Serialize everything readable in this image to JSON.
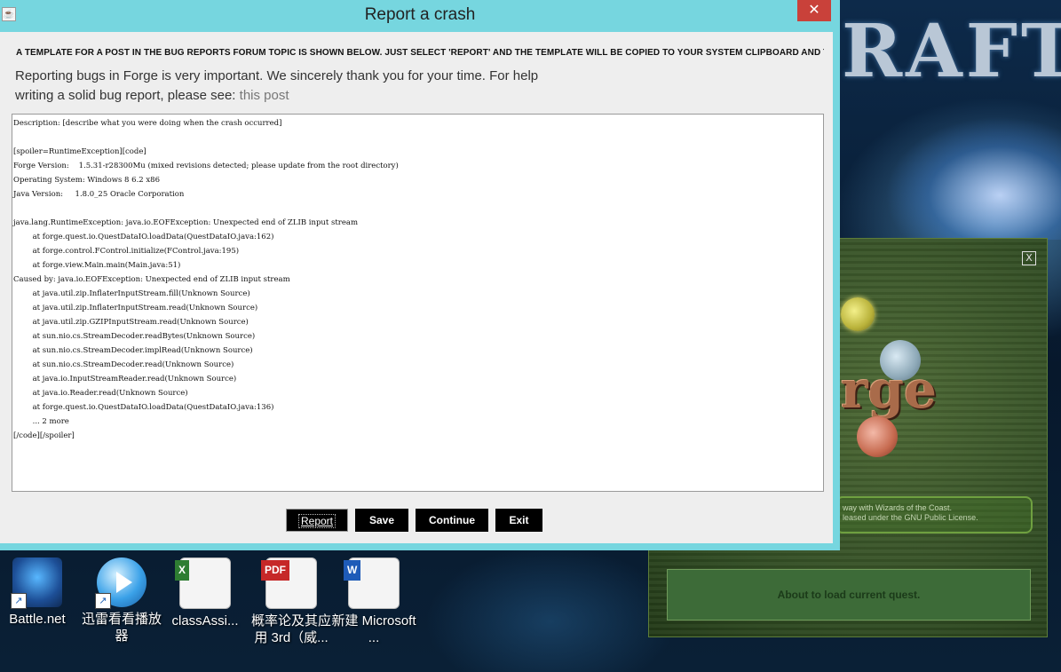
{
  "window": {
    "title": "Report a crash",
    "close_glyph": "✕",
    "app_icon": "java-cup-icon"
  },
  "dialog": {
    "template_note": "A TEMPLATE FOR A POST IN THE BUG REPORTS FORUM TOPIC IS SHOWN BELOW. JUST SELECT 'REPORT' AND THE TEMPLATE WILL BE COPIED TO YOUR SYSTEM CLIPBOARD AND THE FORUM PAGE WILL OPEN IN YOU",
    "intro_line1": "Reporting bugs in Forge is very important. We sincerely thank you for your time. For help",
    "intro_line2": "writing a solid bug report, please see:",
    "link_text": "this post",
    "report_text": "Description: [describe what you were doing when the crash occurred]\n\n[spoiler=RuntimeException][code]\nForge Version:    1.5.31-r28300Mu (mixed revisions detected; please update from the root directory)\nOperating System: Windows 8 6.2 x86\nJava Version:     1.8.0_25 Oracle Corporation\n\njava.lang.RuntimeException: java.io.EOFException: Unexpected end of ZLIB input stream\n        at forge.quest.io.QuestDataIO.loadData(QuestDataIO.java:162)\n        at forge.control.FControl.initialize(FControl.java:195)\n        at forge.view.Main.main(Main.java:51)\nCaused by: java.io.EOFException: Unexpected end of ZLIB input stream\n        at java.util.zip.InflaterInputStream.fill(Unknown Source)\n        at java.util.zip.InflaterInputStream.read(Unknown Source)\n        at java.util.zip.GZIPInputStream.read(Unknown Source)\n        at sun.nio.cs.StreamDecoder.readBytes(Unknown Source)\n        at sun.nio.cs.StreamDecoder.implRead(Unknown Source)\n        at sun.nio.cs.StreamDecoder.read(Unknown Source)\n        at java.io.InputStreamReader.read(Unknown Source)\n        at java.io.Reader.read(Unknown Source)\n        at forge.quest.io.QuestDataIO.loadData(QuestDataIO.java:136)\n        ... 2 more\n[/code][/spoiler]",
    "buttons": {
      "report": "Report",
      "save": "Save",
      "continue": "Continue",
      "exit": "Exit"
    }
  },
  "splash": {
    "close_glyph": "X",
    "logo_text": "rge",
    "license_line1": "way with Wizards of the Coast.",
    "license_line2": "leased under the GNU Public License.",
    "status": "About to load current quest."
  },
  "background": {
    "logo_text": "RAFT"
  },
  "desktop_icons": [
    {
      "label": "Battle.net",
      "icon": "battlenet-icon"
    },
    {
      "label": "迅雷看看播放器",
      "icon": "xunlei-player-icon"
    },
    {
      "label": "classAssi...",
      "icon": "excel-file-icon"
    },
    {
      "label": "概率论及其应用 3rd（威...",
      "icon": "pdf-file-icon",
      "badge": "PDF"
    },
    {
      "label": "新建 Microsoft ...",
      "icon": "word-file-icon",
      "badge": "W"
    }
  ],
  "colors": {
    "title_bar": "#76d6df",
    "close_button": "#c9413a",
    "button_bg": "#000000",
    "splash_green": "#3d6b38"
  }
}
